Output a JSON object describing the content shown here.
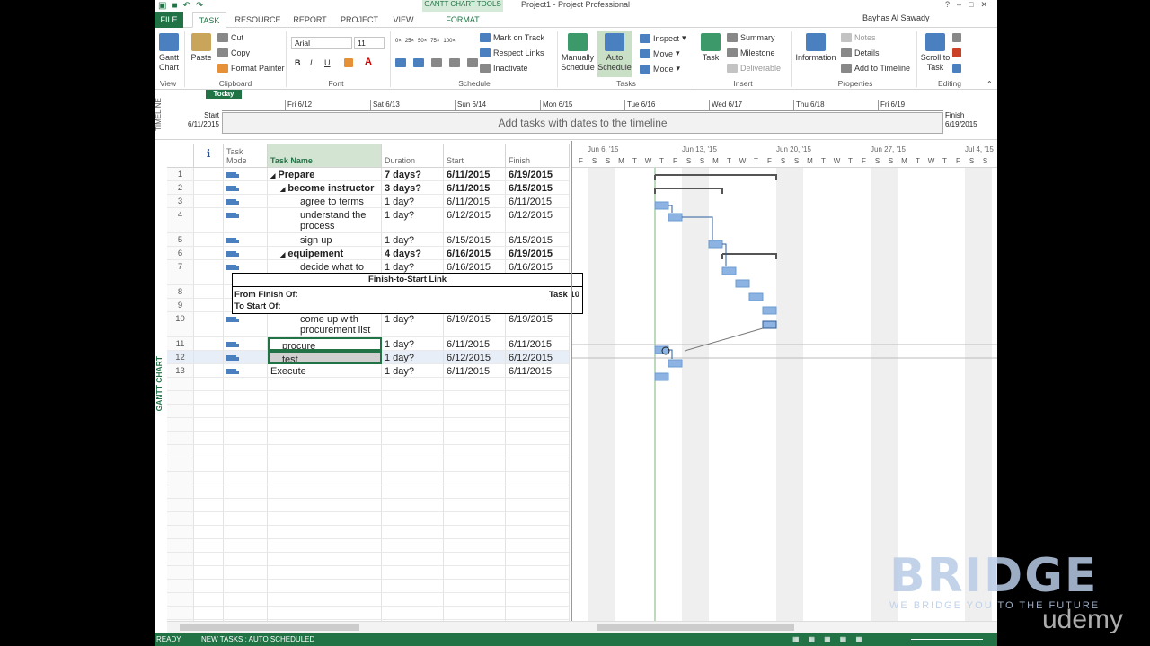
{
  "title_bar": {
    "contextual_tab_group": "GANTT CHART TOOLS",
    "window_title": "Project1 - Project Professional",
    "user": "Bayhas Al Sawady",
    "buttons": [
      "?",
      "–",
      "□",
      "✕"
    ]
  },
  "tabs": [
    {
      "label": "FILE"
    },
    {
      "label": "TASK"
    },
    {
      "label": "RESOURCE"
    },
    {
      "label": "REPORT"
    },
    {
      "label": "PROJECT"
    },
    {
      "label": "VIEW"
    },
    {
      "label": "FORMAT"
    }
  ],
  "ribbon": {
    "view": {
      "gantt_chart": "Gantt Chart",
      "label": "View"
    },
    "clipboard": {
      "paste": "Paste",
      "cut": "Cut",
      "copy": "Copy",
      "format_painter": "Format Painter",
      "label": "Clipboard"
    },
    "font": {
      "family": "Arial",
      "size": "11",
      "bold": "B",
      "italic": "I",
      "underline": "U",
      "label": "Font"
    },
    "schedule": {
      "pct": [
        "0×",
        "25×",
        "50×",
        "75×",
        "100×"
      ],
      "mark_on_track": "Mark on Track",
      "respect_links": "Respect Links",
      "inactivate": "Inactivate",
      "label": "Schedule"
    },
    "tasks": {
      "manually_schedule": "Manually Schedule",
      "auto_schedule": "Auto Schedule",
      "inspect": "Inspect",
      "move": "Move",
      "mode": "Mode",
      "label": "Tasks"
    },
    "insert": {
      "task": "Task",
      "summary": "Summary",
      "milestone": "Milestone",
      "deliverable": "Deliverable",
      "label": "Insert"
    },
    "properties": {
      "information": "Information",
      "notes": "Notes",
      "details": "Details",
      "add_to_timeline": "Add to Timeline",
      "label": "Properties"
    },
    "editing": {
      "scroll_to_task": "Scroll to Task",
      "label": "Editing"
    }
  },
  "timeline": {
    "side_label": "TIMELINE",
    "today": "Today",
    "start_label": "Start",
    "start_date": "6/11/2015",
    "finish_label": "Finish",
    "finish_date": "6/19/2015",
    "ticks": [
      "Fri 6/12",
      "Sat 6/13",
      "Sun 6/14",
      "Mon 6/15",
      "Tue 6/16",
      "Wed 6/17",
      "Thu 6/18",
      "Fri 6/19"
    ],
    "placeholder": "Add tasks with dates to the timeline"
  },
  "table": {
    "side_label": "GANTT CHART",
    "headers": {
      "info": "ℹ",
      "task_mode": "Task Mode",
      "task_name": "Task Name",
      "duration": "Duration",
      "start": "Start",
      "finish": "Finish"
    },
    "rows": [
      {
        "id": "1",
        "name": "Prepare",
        "duration": "7 days?",
        "start": "6/11/2015",
        "finish": "6/19/2015"
      },
      {
        "id": "2",
        "name": "become instructor",
        "duration": "3 days?",
        "start": "6/11/2015",
        "finish": "6/15/2015"
      },
      {
        "id": "3",
        "name": "agree to terms",
        "duration": "1 day?",
        "start": "6/11/2015",
        "finish": "6/11/2015"
      },
      {
        "id": "4",
        "name": "understand the process",
        "duration": "1 day?",
        "start": "6/12/2015",
        "finish": "6/12/2015"
      },
      {
        "id": "5",
        "name": "sign up",
        "duration": "1 day?",
        "start": "6/15/2015",
        "finish": "6/15/2015"
      },
      {
        "id": "6",
        "name": "equipement",
        "duration": "4 days?",
        "start": "6/16/2015",
        "finish": "6/19/2015"
      },
      {
        "id": "7",
        "name": "decide what to",
        "duration": "1 day?",
        "start": "6/16/2015",
        "finish": "6/16/2015"
      },
      {
        "id": "8",
        "name": "",
        "duration": "",
        "start": "",
        "finish": ""
      },
      {
        "id": "9",
        "name": "",
        "duration": "",
        "start": "",
        "finish": ""
      },
      {
        "id": "10",
        "name": "come up with procurement list",
        "duration": "1 day?",
        "start": "6/19/2015",
        "finish": "6/19/2015"
      },
      {
        "id": "11",
        "name": "procure",
        "duration": "1 day?",
        "start": "6/11/2015",
        "finish": "6/11/2015"
      },
      {
        "id": "12",
        "name": "test",
        "duration": "1 day?",
        "start": "6/12/2015",
        "finish": "6/12/2015"
      },
      {
        "id": "13",
        "name": "Execute",
        "duration": "1 day?",
        "start": "6/11/2015",
        "finish": "6/11/2015"
      }
    ]
  },
  "link_tooltip": {
    "title": "Finish-to-Start Link",
    "from_label": "From Finish Of:",
    "from_task": "Task 10",
    "to_label": "To Start Of:"
  },
  "gantt": {
    "weeks": [
      "Jun 6, '15",
      "Jun 13, '15",
      "Jun 20, '15",
      "Jun 27, '15",
      "Jul 4, '15"
    ],
    "days": [
      "F",
      "S",
      "S",
      "M",
      "T",
      "W",
      "T",
      "F",
      "S",
      "S",
      "M",
      "T",
      "W",
      "T",
      "F",
      "S",
      "S",
      "M",
      "T",
      "W",
      "T",
      "F",
      "S",
      "S",
      "M",
      "T",
      "W",
      "T",
      "F",
      "S",
      "S"
    ]
  },
  "status": {
    "ready": "READY",
    "new_tasks": "NEW TASKS : AUTO SCHEDULED"
  },
  "watermark": {
    "brand": "BRIDGE",
    "tagline": "WE BRIDGE YOU TO THE FUTURE",
    "platform": "udemy"
  }
}
